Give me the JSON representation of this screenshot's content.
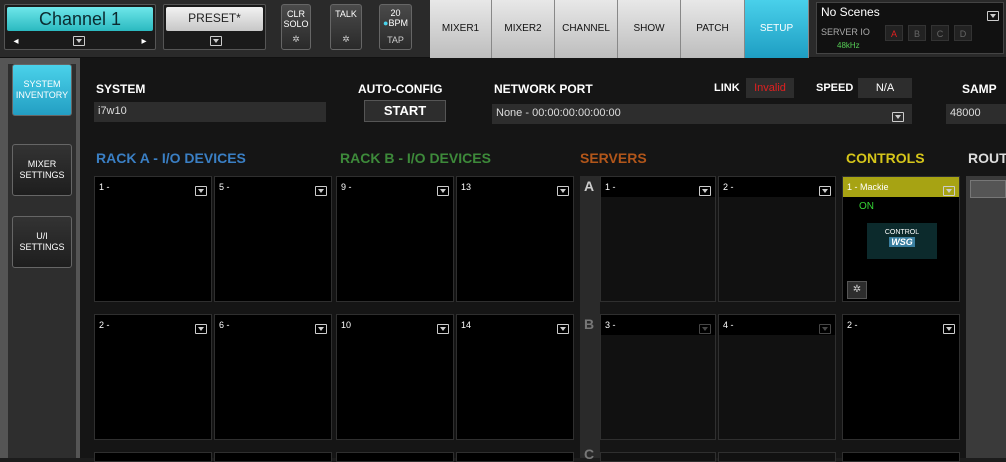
{
  "topbar": {
    "channel_name": "Channel 1",
    "preset_label": "PRESET*",
    "clr_solo": "CLR\nSOLO",
    "talk": "TALK",
    "bpm_value": "20",
    "bpm_unit": "BPM",
    "tap": "TAP",
    "tabs": [
      {
        "label": "MIXER1"
      },
      {
        "label": "MIXER2"
      },
      {
        "label": "CHANNEL"
      },
      {
        "label": "SHOW"
      },
      {
        "label": "PATCH"
      },
      {
        "label": "SETUP",
        "active": true
      }
    ],
    "scenes_title": "No Scenes",
    "server_io": "SERVER IO",
    "server_letters": [
      "A",
      "B",
      "C",
      "D"
    ],
    "sample_rate": "48kHz"
  },
  "sidebar": {
    "items": [
      {
        "label": "SYSTEM INVENTORY",
        "active": true
      },
      {
        "label": "MIXER SETTINGS"
      },
      {
        "label": "U/I SETTINGS"
      }
    ]
  },
  "system": {
    "label": "SYSTEM",
    "value": "i7w10",
    "auto_config_label": "AUTO-CONFIG",
    "start_label": "START",
    "network_port_label": "NETWORK PORT",
    "network_port_value": "None - 00:00:00:00:00:00",
    "link_label": "LINK",
    "link_value": "Invalid",
    "speed_label": "SPEED",
    "speed_value": "N/A",
    "samp_label": "SAMP",
    "samp_value": "48000"
  },
  "sections": {
    "rack_a": "RACK A - I/O DEVICES",
    "rack_b": "RACK B - I/O DEVICES",
    "servers": "SERVERS",
    "controls": "CONTROLS",
    "routing": "ROUT"
  },
  "rack_a_tiles": [
    "1 -",
    "5 -",
    "2 -",
    "6 -"
  ],
  "rack_b_tiles": [
    "9 -",
    "13",
    "10",
    "14"
  ],
  "servers": {
    "letters": [
      "A",
      "B",
      "C"
    ],
    "tiles": [
      "1 -",
      "2 -",
      "3 -",
      "4 -"
    ]
  },
  "controls": {
    "tile1_label": "1 - Mackie",
    "tile1_status": "ON",
    "logo_text_top": "CONTROL",
    "logo_text_bottom": "WSG",
    "tile2_label": "2 -"
  },
  "colors": {
    "accent": "#2bb9c0",
    "rack_a": "#3a7fc4",
    "rack_b": "#3d8a3a",
    "servers": "#b2561a",
    "controls": "#d6c61a",
    "link_invalid": "#e02020",
    "on_green": "#36d636"
  }
}
